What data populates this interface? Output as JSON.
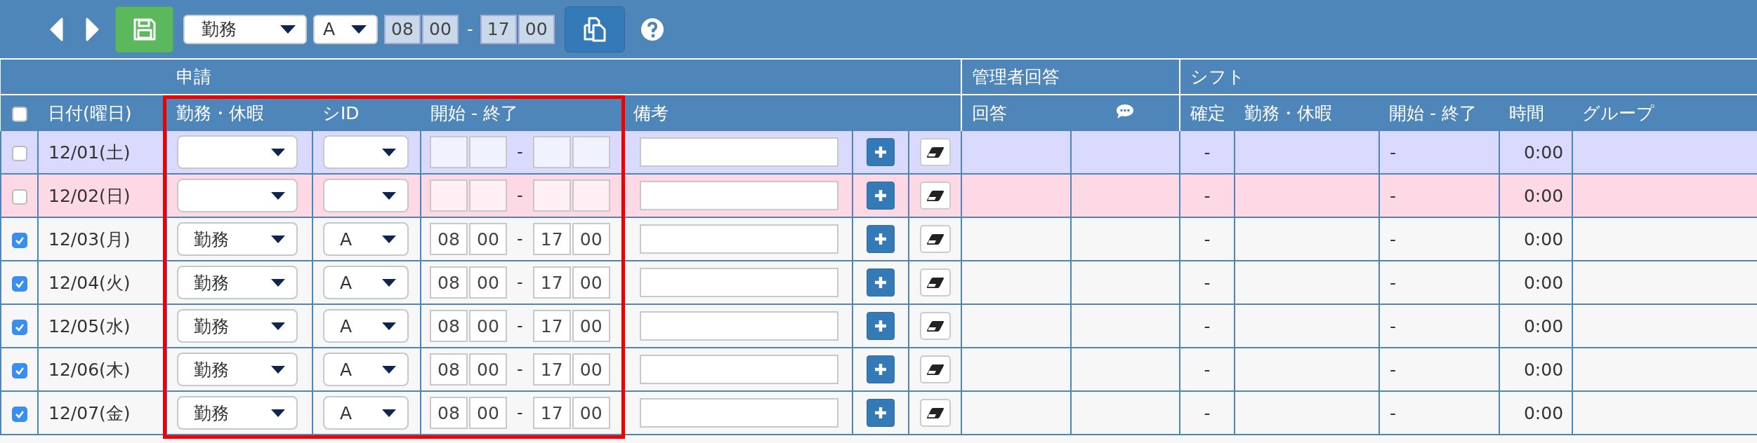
{
  "toolbar": {
    "work_select": "勤務",
    "sid_select": "A",
    "start_hour": "08",
    "start_minute": "00",
    "separator": "-",
    "end_hour": "17",
    "end_minute": "00"
  },
  "group_headers": {
    "request": "申請",
    "manager_reply": "管理者回答",
    "shift": "シフト"
  },
  "columns": {
    "select_all_checked": false,
    "date": "日付(曜日)",
    "work": "勤務・休暇",
    "sid": "シID",
    "time": "開始 - 終了",
    "note": "備考",
    "reply": "回答",
    "confirmed": "確定",
    "shift_work": "勤務・休暇",
    "shift_time": "開始 - 終了",
    "hours": "時間",
    "group": "グループ"
  },
  "rows": [
    {
      "kind": "saturday",
      "checked": false,
      "date": "12/01(土)",
      "separator": "-",
      "confirmed": "-",
      "shift_time": "-",
      "hours": "0:00"
    },
    {
      "kind": "sunday",
      "checked": false,
      "date": "12/02(日)",
      "separator": "-",
      "confirmed": "-",
      "shift_time": "-",
      "hours": "0:00"
    },
    {
      "kind": "weekday",
      "checked": true,
      "date": "12/03(月)",
      "work": "勤務",
      "sid": "A",
      "start_hour": "08",
      "start_minute": "00",
      "separator": "-",
      "end_hour": "17",
      "end_minute": "00",
      "confirmed": "-",
      "shift_time": "-",
      "hours": "0:00"
    },
    {
      "kind": "weekday",
      "checked": true,
      "date": "12/04(火)",
      "work": "勤務",
      "sid": "A",
      "start_hour": "08",
      "start_minute": "00",
      "separator": "-",
      "end_hour": "17",
      "end_minute": "00",
      "confirmed": "-",
      "shift_time": "-",
      "hours": "0:00"
    },
    {
      "kind": "weekday",
      "checked": true,
      "date": "12/05(水)",
      "work": "勤務",
      "sid": "A",
      "start_hour": "08",
      "start_minute": "00",
      "separator": "-",
      "end_hour": "17",
      "end_minute": "00",
      "confirmed": "-",
      "shift_time": "-",
      "hours": "0:00"
    },
    {
      "kind": "weekday",
      "checked": true,
      "date": "12/06(木)",
      "work": "勤務",
      "sid": "A",
      "start_hour": "08",
      "start_minute": "00",
      "separator": "-",
      "end_hour": "17",
      "end_minute": "00",
      "confirmed": "-",
      "shift_time": "-",
      "hours": "0:00"
    },
    {
      "kind": "weekday",
      "checked": true,
      "date": "12/07(金)",
      "work": "勤務",
      "sid": "A",
      "start_hour": "08",
      "start_minute": "00",
      "separator": "-",
      "end_hour": "17",
      "end_minute": "00",
      "confirmed": "-",
      "shift_time": "-",
      "hours": "0:00"
    }
  ]
}
